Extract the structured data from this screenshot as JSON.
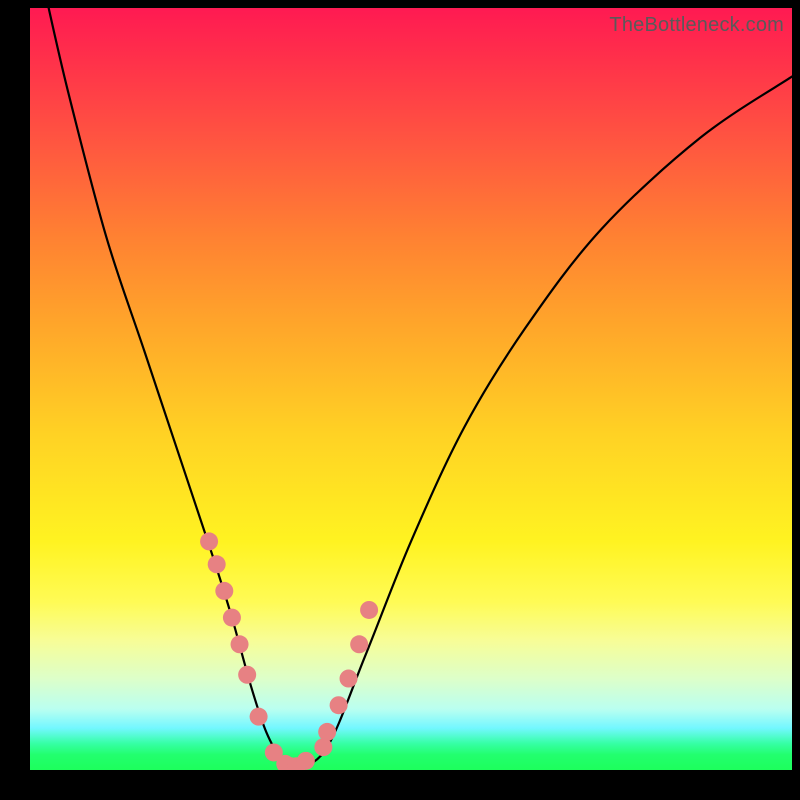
{
  "watermark": "TheBottleneck.com",
  "colors": {
    "top": "#ff1a52",
    "mid": "#fff321",
    "bottom": "#1dff5c",
    "border_bg": "#000000",
    "curve": "#000000",
    "dots": "#e78183",
    "watermark_text": "#5a5a5a"
  },
  "chart_data": {
    "type": "line",
    "title": "",
    "xlabel": "",
    "ylabel": "",
    "xlim": [
      0,
      100
    ],
    "ylim": [
      0,
      100
    ],
    "grid": false,
    "legend": false,
    "series": [
      {
        "name": "curve",
        "kind": "spline",
        "x": [
          2,
          5,
          10,
          15,
          20,
          24,
          26.5,
          29,
          31,
          33,
          35,
          39,
          44,
          50,
          57,
          65,
          75,
          88,
          100
        ],
        "y": [
          102,
          89,
          70,
          55,
          40,
          28,
          20,
          11,
          5,
          1.5,
          0.3,
          3,
          15,
          30,
          45,
          58,
          71,
          83,
          91
        ]
      },
      {
        "name": "dots",
        "kind": "scatter",
        "x": [
          23.5,
          24.5,
          25.5,
          26.5,
          27.5,
          28.5,
          30.0,
          32.0,
          33.5,
          34.2,
          35.0,
          36.2,
          38.5,
          39.0,
          40.5,
          41.8,
          43.2,
          44.5
        ],
        "y": [
          30.0,
          27.0,
          23.5,
          20.0,
          16.5,
          12.5,
          7.0,
          2.3,
          0.8,
          0.5,
          0.5,
          1.2,
          3.0,
          5.0,
          8.5,
          12.0,
          16.5,
          21.0
        ]
      }
    ]
  }
}
